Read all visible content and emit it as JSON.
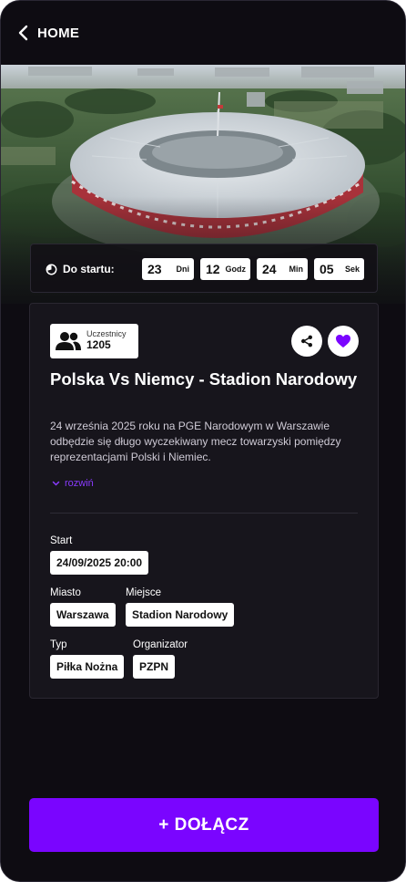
{
  "header": {
    "back_label": "HOME"
  },
  "hero": {
    "image_name": "stadium-aerial-photo"
  },
  "countdown": {
    "label": "Do startu:",
    "days": {
      "value": "23",
      "unit": "Dni"
    },
    "hours": {
      "value": "12",
      "unit": "Godz"
    },
    "minutes": {
      "value": "24",
      "unit": "Min"
    },
    "seconds": {
      "value": "05",
      "unit": "Sek"
    }
  },
  "event": {
    "participants_label": "Uczestnicy",
    "participants_count": "1205",
    "title": "Polska Vs Niemcy - Stadion Narodowy",
    "description": "24 września 2025 roku na PGE Narodowym w Warszawie odbędzie się długo wyczekiwany mecz towarzyski pomiędzy reprezentacjami Polski i Niemiec.",
    "expand_label": "rozwiń",
    "start_label": "Start",
    "start_value": "24/09/2025 20:00",
    "city_label": "Miasto",
    "city_value": "Warszawa",
    "place_label": "Miejsce",
    "place_value": "Stadion Narodowy",
    "type_label": "Typ",
    "type_value": "Piłka Nożna",
    "organizer_label": "Organizator",
    "organizer_value": "PZPN"
  },
  "actions": {
    "join_label": "+ DOŁĄCZ"
  },
  "colors": {
    "accent": "#7a05ff",
    "background": "#0e0c12",
    "card": "#17151c"
  }
}
